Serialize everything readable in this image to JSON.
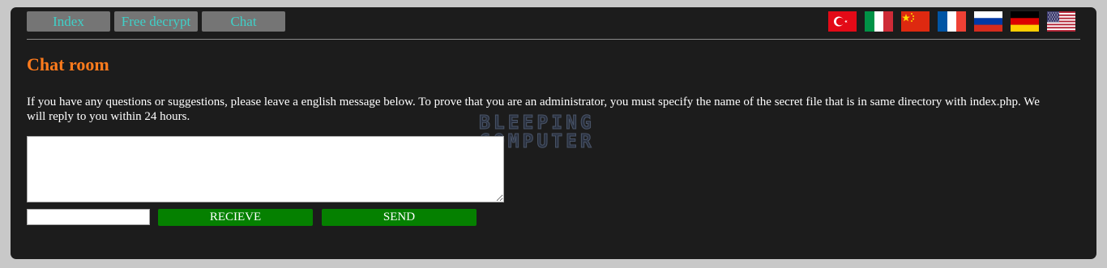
{
  "nav": [
    {
      "label": "Index"
    },
    {
      "label": "Free decrypt"
    },
    {
      "label": "Chat"
    }
  ],
  "flags": [
    "turkey-flag-icon",
    "italy-flag-icon",
    "china-flag-icon",
    "france-flag-icon",
    "russia-flag-icon",
    "germany-flag-icon",
    "usa-flag-icon"
  ],
  "page": {
    "title": "Chat room",
    "description": "If you have any questions or suggestions, please leave a english message below. To prove that you are an administrator, you must specify the name of the secret file that is in same directory with index.php. We will reply to you within 24 hours."
  },
  "watermark": {
    "line1": "BLEEPING",
    "line2": "COMPUTER"
  },
  "form": {
    "message_value": "",
    "code_value": "",
    "receive_label": "RECIEVE",
    "send_label": "SEND"
  },
  "colors": {
    "panel_bg": "#1c1c1c",
    "title": "#ff7b1c",
    "nav_text": "#3fd0c8",
    "nav_bg": "#757575",
    "button_green": "#058000"
  }
}
